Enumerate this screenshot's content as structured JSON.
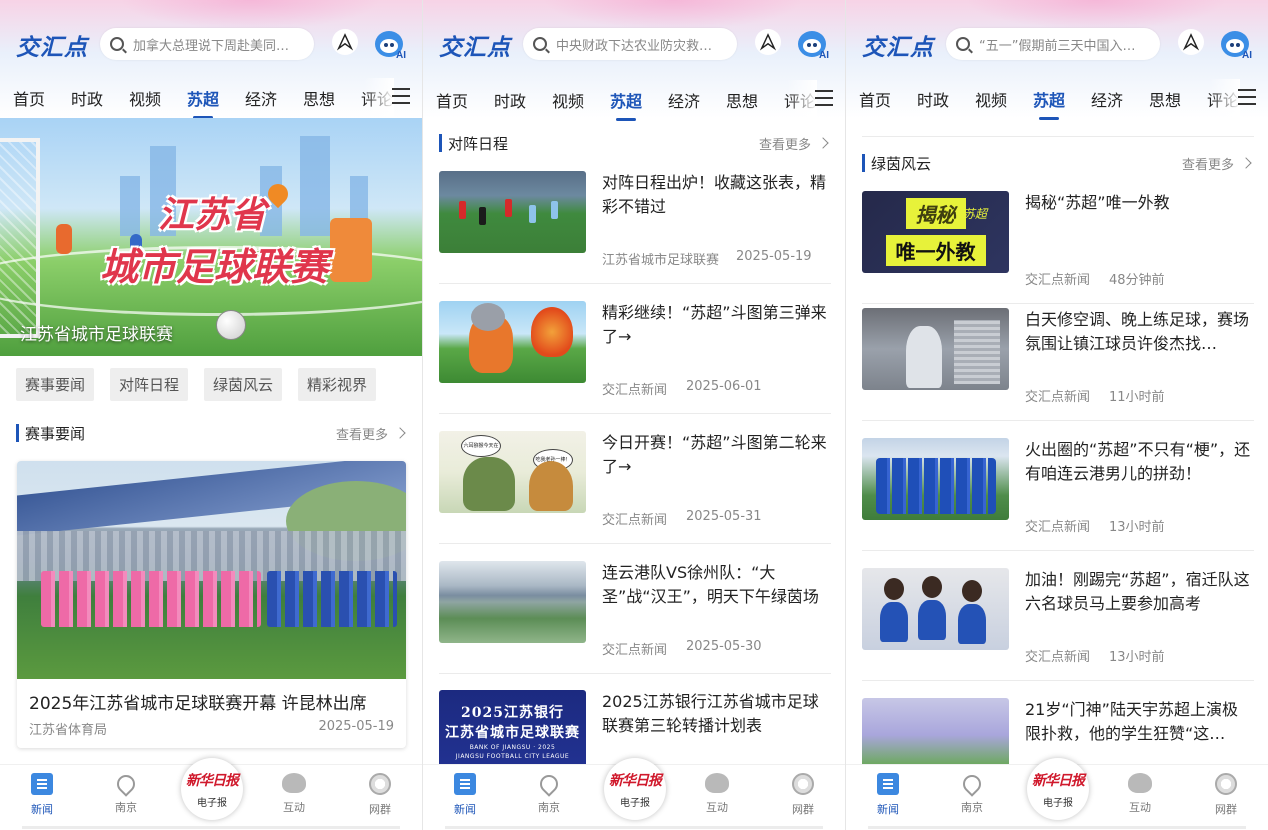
{
  "screens": [
    {
      "logo": "交汇点",
      "search_placeholder": "加拿大总理说下周赴美同…",
      "tabs": [
        "首页",
        "时政",
        "视频",
        "苏超",
        "经济",
        "思想",
        "评论"
      ],
      "active_tab": 3,
      "hero_title_line1": "江苏省",
      "hero_title_line2": "城市足球联赛",
      "hero_caption": "江苏省城市足球联赛",
      "chips": [
        "赛事要闻",
        "对阵日程",
        "绿茵风云",
        "精彩视界"
      ],
      "section": {
        "title": "赛事要闻",
        "more": "查看更多"
      },
      "featured": {
        "title": "2025年江苏省城市足球联赛开幕 许昆林出席",
        "source": "江苏省体育局",
        "date": "2025-05-19"
      }
    },
    {
      "logo": "交汇点",
      "search_placeholder": "中央财政下达农业防灾救…",
      "tabs": [
        "首页",
        "时政",
        "视频",
        "苏超",
        "经济",
        "思想",
        "评论"
      ],
      "section": {
        "title": "对阵日程",
        "more": "查看更多"
      },
      "items": [
        {
          "title": "对阵日程出炉！收藏这张表，精彩不错过",
          "source": "江苏省城市足球联赛",
          "time": "2025-05-19"
        },
        {
          "title": "精彩继续！“苏超”斗图第三弹来了→",
          "source": "交汇点新闻",
          "time": "2025-06-01"
        },
        {
          "title": "今日开赛！“苏超”斗图第二轮来了→",
          "source": "交汇点新闻",
          "time": "2025-05-31"
        },
        {
          "title": "连云港队VS徐州队：“大圣”战“汉王”，明天下午绿茵场上…",
          "source": "交汇点新闻",
          "time": "2025-05-30"
        },
        {
          "title": "2025江苏银行江苏省城市足球联赛第三轮转播计划表",
          "source": "",
          "time": ""
        }
      ],
      "thumb3_bubbles": [
        "六耳猕猴今天在哪！",
        "吃我老孙一棒！"
      ],
      "thumb5_text": [
        "2025江苏银行",
        "江苏省城市足球联赛",
        "BANK OF JIANGSU · 2025",
        "JIANGSU FOOTBALL CITY LEAGUE"
      ]
    },
    {
      "logo": "交汇点",
      "search_placeholder": "“五一”假期前三天中国入…",
      "tabs": [
        "首页",
        "时政",
        "视频",
        "苏超",
        "经济",
        "思想",
        "评论"
      ],
      "section": {
        "title": "绿茵风云",
        "more": "查看更多"
      },
      "items": [
        {
          "title": "揭秘“苏超”唯一外教",
          "source": "交汇点新闻",
          "time": "48分钟前"
        },
        {
          "title": "白天修空调、晚上练足球，赛场氛围让镇江球员许俊杰找…",
          "source": "交汇点新闻",
          "time": "11小时前"
        },
        {
          "title": "火出圈的“苏超”不只有“梗”，还有咱连云港男儿的拼劲！",
          "source": "交汇点新闻",
          "time": "13小时前"
        },
        {
          "title": "加油！刚踢完“苏超”，宿迁队这六名球员马上要参加高考",
          "source": "交汇点新闻",
          "time": "13小时前"
        },
        {
          "title": "21岁“门神”陆天宇苏超上演极限扑救，他的学生狂赞“这…",
          "source": "",
          "time": ""
        }
      ],
      "thumb1_text": [
        "揭秘",
        "苏超",
        "唯一外教"
      ]
    }
  ],
  "bottom_nav": [
    "新闻",
    "南京",
    "互动",
    "网群"
  ],
  "center_button": {
    "logo": "新华日报",
    "label": "电子报"
  },
  "colors": {
    "accent": "#1d55b8",
    "muted": "#888888"
  }
}
